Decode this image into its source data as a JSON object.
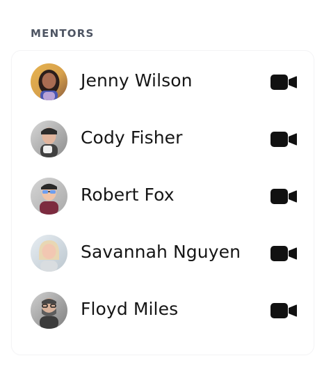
{
  "section": {
    "title": "MENTORS"
  },
  "mentors": [
    {
      "name": "Jenny Wilson",
      "action_icon": "video-camera-icon"
    },
    {
      "name": "Cody Fisher",
      "action_icon": "video-camera-icon"
    },
    {
      "name": "Robert Fox",
      "action_icon": "video-camera-icon"
    },
    {
      "name": "Savannah Nguyen",
      "action_icon": "video-camera-icon"
    },
    {
      "name": "Floyd Miles",
      "action_icon": "video-camera-icon"
    }
  ],
  "colors": {
    "background": "#ffffff",
    "title": "#4e5563",
    "text": "#151515",
    "icon": "#111111"
  }
}
